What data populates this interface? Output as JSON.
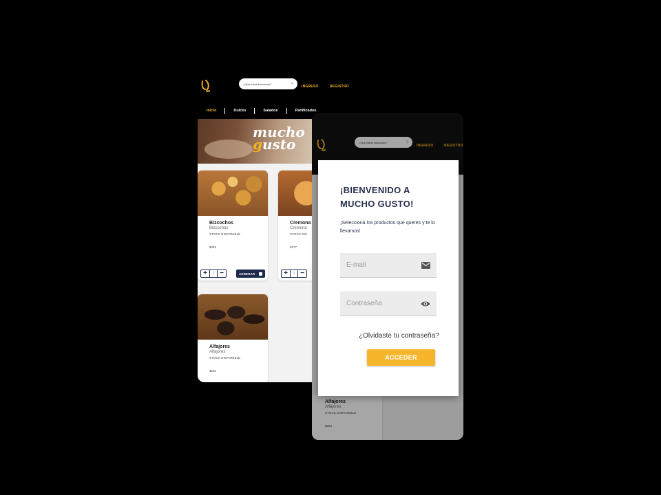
{
  "back_screen": {
    "search": {
      "placeholder": "¿Que estas buscando?"
    },
    "header": {
      "login_link": "INGRESO",
      "register_link": "REGISTRO"
    },
    "menu": [
      "Inicio",
      "Dulces",
      "Salados",
      "Panificados"
    ],
    "hero": {
      "line1": "mucho",
      "line2_accent": "g",
      "line2": "usto"
    },
    "products": [
      {
        "name": "Bizcochos",
        "subtitle": "Bizcochos",
        "stock": "STOCK DISPONIBLE",
        "price": "$253",
        "qty": "1",
        "add_label": "AGREGAR"
      },
      {
        "name": "Cremona",
        "subtitle": "Cremona",
        "stock": "STOCK DIS",
        "price": "$177",
        "qty": "1"
      },
      {
        "name": "Alfajores",
        "subtitle": "Alfajores",
        "stock": "STOCK DISPONIBLE",
        "price": "$253"
      }
    ]
  },
  "front_screen": {
    "search": {
      "placeholder": "¿Que estas buscando?"
    },
    "header": {
      "login_link": "INGRESO",
      "register_link": "REGISTRO"
    },
    "bottom_product": {
      "name": "Alfajores",
      "subtitle": "Alfajores",
      "stock": "STOCK DISPONIBLE",
      "price": "$253"
    }
  },
  "login_modal": {
    "title": "¡BIENVENIDO A MUCHO GUSTO!",
    "subtitle": "¡Seleccioná los productos que queres y te lo llevamos!",
    "email_placeholder": "E-mail",
    "password_placeholder": "Contraseña",
    "forgot_password": "¿Olvidaste tu contraseña?",
    "submit_label": "ACCEDER"
  },
  "colors": {
    "accent": "#f5b31c",
    "navy": "#1d2b4f",
    "button": "#f7b52c",
    "title": "#26304d"
  },
  "icons": [
    "logo-icon",
    "search-icon",
    "plus-icon",
    "minus-icon",
    "bag-icon",
    "mail-icon",
    "eye-icon"
  ]
}
